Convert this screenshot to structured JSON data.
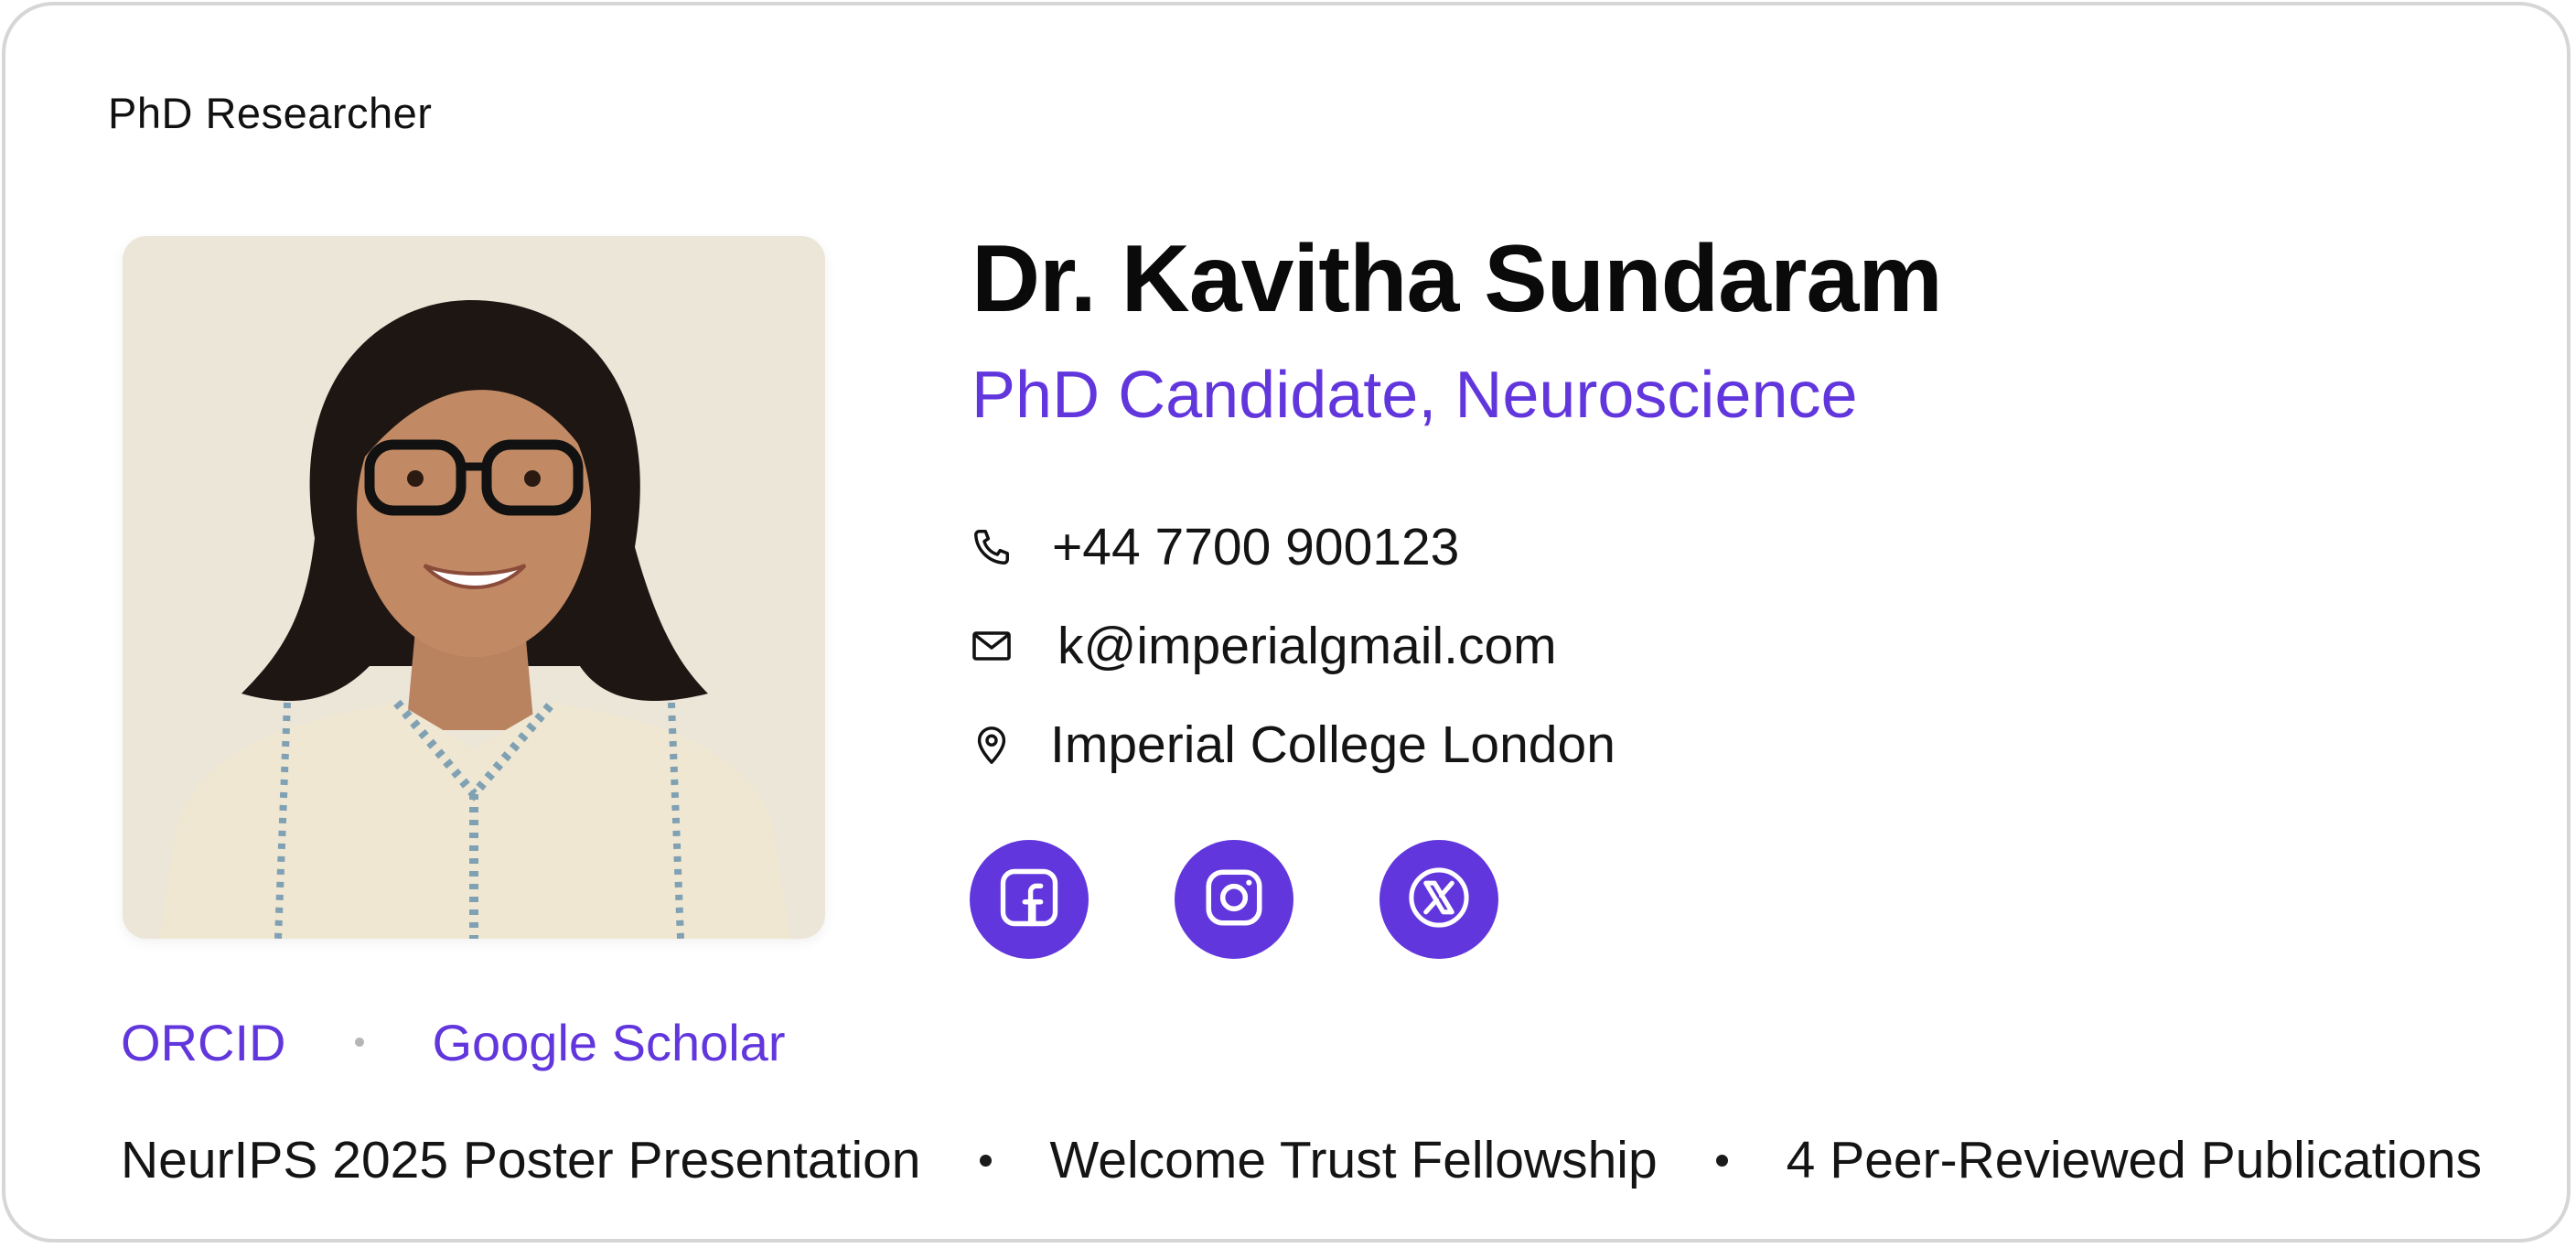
{
  "card": {
    "eyebrow": "PhD Researcher",
    "name": "Dr. Kavitha Sundaram",
    "subtitle": "PhD Candidate, Neuroscience",
    "contacts": [
      {
        "icon": "phone-icon",
        "text": "+44 7700 900123"
      },
      {
        "icon": "mail-icon",
        "text": "k@imperialgmail.com"
      },
      {
        "icon": "location-pin-icon",
        "text": "Imperial College London"
      }
    ],
    "social": [
      {
        "icon": "facebook-icon"
      },
      {
        "icon": "instagram-icon"
      },
      {
        "icon": "x-twitter-icon"
      }
    ],
    "links": [
      "ORCID",
      "Google Scholar"
    ],
    "awards": [
      "NeurIPS 2025 Poster Presentation",
      "Welcome Trust Fellowship",
      "4 Peer-Reviewed Publications"
    ]
  },
  "colors": {
    "accent": "#6236dd",
    "text": "#111111",
    "border": "#d6d6d6"
  }
}
